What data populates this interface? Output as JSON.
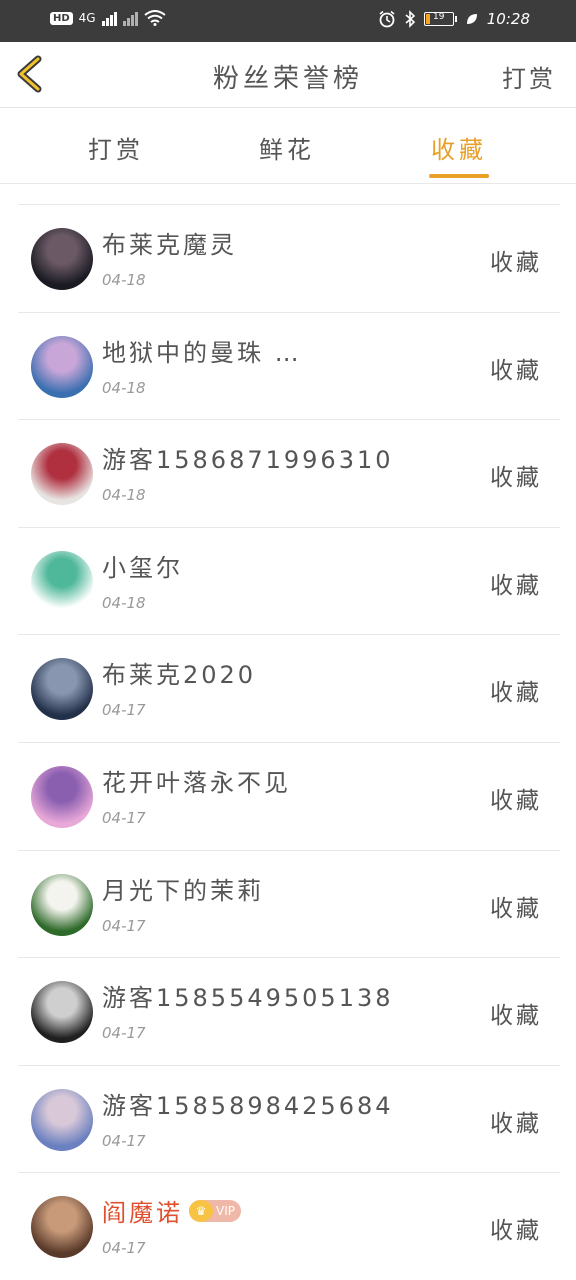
{
  "status_bar": {
    "network_badge": "HD",
    "network_type": "4G",
    "battery_level": "19",
    "time": "10:28"
  },
  "header": {
    "title": "粉丝荣誉榜",
    "action": "打赏"
  },
  "tabs": [
    {
      "label": "打赏",
      "active": false
    },
    {
      "label": "鲜花",
      "active": false
    },
    {
      "label": "收藏",
      "active": true
    }
  ],
  "list": [
    {
      "name": "布莱克魔灵",
      "date": "04-18",
      "action": "收藏",
      "avatar_colors": [
        "#1a1a22",
        "#6b5a66"
      ]
    },
    {
      "name": "地狱中的曼珠 …",
      "date": "04-18",
      "action": "收藏",
      "avatar_colors": [
        "#3a6fb0",
        "#c9a6d8"
      ]
    },
    {
      "name": "游客1586871996310",
      "date": "04-18",
      "action": "收藏",
      "avatar_colors": [
        "#e8e4e2",
        "#b03040"
      ]
    },
    {
      "name": "小玺尔",
      "date": "04-18",
      "action": "收藏",
      "avatar_colors": [
        "#ffffff",
        "#4fb89a"
      ]
    },
    {
      "name": "布莱克2020",
      "date": "04-17",
      "action": "收藏",
      "avatar_colors": [
        "#22304a",
        "#8896b0"
      ]
    },
    {
      "name": "花开叶落永不见",
      "date": "04-17",
      "action": "收藏",
      "avatar_colors": [
        "#e8a8d8",
        "#8a5fb0"
      ]
    },
    {
      "name": "月光下的茉莉",
      "date": "04-17",
      "action": "收藏",
      "avatar_colors": [
        "#2e6a2a",
        "#f4f4ee"
      ]
    },
    {
      "name": "游客1585549505138",
      "date": "04-17",
      "action": "收藏",
      "avatar_colors": [
        "#202020",
        "#cfcfcf"
      ]
    },
    {
      "name": "游客1585898425684",
      "date": "04-17",
      "action": "收藏",
      "avatar_colors": [
        "#6a80c0",
        "#d8c8d8"
      ]
    },
    {
      "name": "阎魔诺",
      "date": "04-17",
      "action": "收藏",
      "vip": true,
      "vip_label": "VIP",
      "avatar_colors": [
        "#5a3a2a",
        "#c89a7a"
      ]
    }
  ],
  "colors": {
    "accent": "#e8a028",
    "vip_name": "#e0502e",
    "status_bar_bg": "#3c3c3c"
  }
}
